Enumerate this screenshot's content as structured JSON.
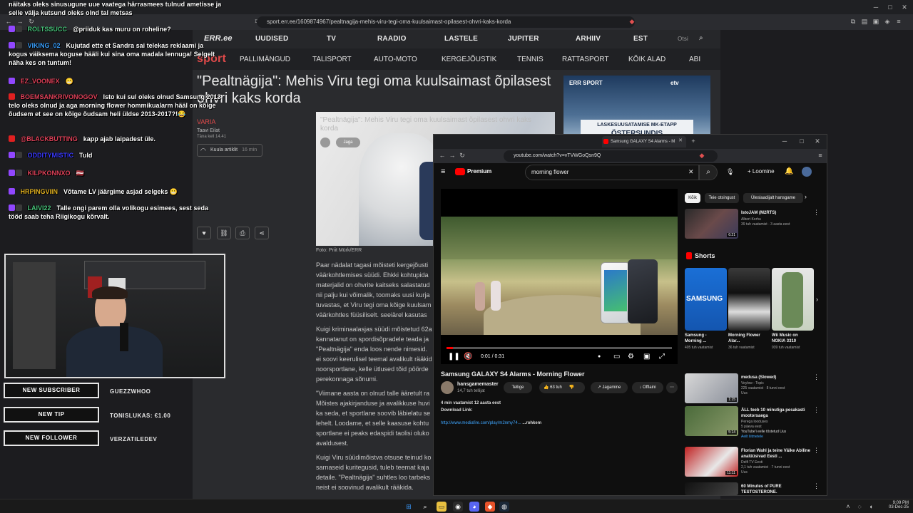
{
  "main_browser": {
    "tab_title": "Samsung GALAXY S4 Alarms - M",
    "url": "sport.err.ee/1609874967/pealtnagija-mehis-viru-tegi-oma-kuulsaimast-opilasest-ohvri-kaks-korda"
  },
  "err": {
    "nav1": [
      "UUDISED",
      "TV",
      "RAADIO",
      "LASTELE",
      "JUPITER",
      "ARHIIV",
      "EST"
    ],
    "search_placeholder": "Otsi",
    "sport_label": "sport",
    "nav2": [
      "PALLIMÄNGUD",
      "TALISPORT",
      "AUTO-MOTO",
      "KERGEJÕUSTIK",
      "TENNIS",
      "RATTASPORT",
      "KÕIK ALAD",
      "ABI"
    ],
    "headline": "\"Pealtnägija\": Mehis Viru tegi oma kuulsaimast õpilasest ohvri kaks korda",
    "category": "VARIA",
    "author": "Taavi Eilat",
    "date": "Täna kell 14.41",
    "listen_label": "Kuula artiklit",
    "listen_duration": "16 min",
    "photo_caption": "Foto: Priit Mürk/ERR",
    "photo_overlay": "\"Pealtnägija\": Mehis Viru tegi oma kuulsaimast õpilasest ohvri kaks korda",
    "photo_share": "Jaga",
    "paragraphs": [
      "Paar nädalat tagasi mõisteti kergejõusti väärkohtlemises süüdi. Ehkki kohtupida materjalid on ohvrite kaitseks salastatud nii palju kui võimalik, toomaks uusi kurja tuvastas, et Viru tegi oma kõige kuulsam väärkohtles füüsiliselt, seejärel kasutas",
      "Kuigi kriminaalasjas süüdi mõistetud 62a kannatanut on spordisõpradele teada ja \"Pealtnägija\" enda loos nende nimesid. ei soovi keerulisel teemal avalikult rääkid noorsportlane, kelle ütlused tõid pöörde perekonnaga sõnumi.",
      "\"Viimane aasta on olnud talle ääretult ra Mõistes ajakirjanduse ja avalikkuse huvi ka seda, et sportlane soovib läbielatu se lehelt. Loodame, et selle kaasuse kohtu sportlane ei peaks edaspidi taolisi oluko avaldusest.",
      "Kuigi Viru süüdimõistva otsuse teinud ko sarnaseid kuritegusid, tuleb teemat kaja detaile. \"Pealtnägija\" suhtles loo tarbeks neist ei soovinud avalikult rääkida."
    ],
    "ad_brand": "ERR SPORT",
    "ad_channel": "etv",
    "ad_text": "LASKESUUSATAMISE MK-ETAPP",
    "ad_text2": "ÖSTERSUNDIS"
  },
  "chat": [
    {
      "user": "",
      "msg": "näitaks oleks sinusugune uue vaatega härrasmees tulnud ametisse ja selle välja kutsund oleks olnd tal metsas",
      "color": "#ffffff"
    },
    {
      "user": "ROLTSSUCC",
      "msg": "@priiduk kas muru on roheline?",
      "color": "#48c27a"
    },
    {
      "user": "VIKING_02",
      "msg": "Kujutad ette et Sandra sai telekas reklaami ja kogus väiksema koguse hääli kui sina oma madala lennuga! Selgelt näha kes on tuntum!",
      "color": "#3aa0ff"
    },
    {
      "user": "EZ_VOONEX",
      "msg": "😬",
      "color": "#e0425a"
    },
    {
      "user": "BOEMSANKRIVONOGOV",
      "msg": "Isto kui sul oleks olnud Samsung 2013 telo oleks olnud ja aga morning flower hommikualarm hääl on kõige õudsem et see on kõige õudsam heli üldse 2013-2017?!😂",
      "color": "#e0425a"
    },
    {
      "user": "@BLACKBUTTING",
      "msg": "kapp ajab laipadest üle.",
      "color": "#e0425a"
    },
    {
      "user": "ODDITYMISTIC",
      "msg": "Tuld",
      "color": "#3a3aff"
    },
    {
      "user": "KILPKONNXO",
      "msg": "🇱🇻",
      "color": "#e0425a"
    },
    {
      "user": "HRPINGVIIN",
      "msg": "Võtame LV jäärgime asjad selgeks 😬",
      "color": "#e0b020"
    },
    {
      "user": "LAIVI22",
      "msg": "Talle ongi parem olla volikogu esimees, sest seda tööd saab teha Riigikogu kõrvalt.",
      "color": "#48c27a"
    }
  ],
  "alerts": [
    {
      "label": "NEW SUBSCRIBER",
      "value": "GUEZZWHOO"
    },
    {
      "label": "NEW TIP",
      "value": "TONISLUKAS: €1.00"
    },
    {
      "label": "NEW FOLLOWER",
      "value": "VERZATILEDEV"
    }
  ],
  "youtube": {
    "tab_title": "Samsung GALAXY S4 Alarms - M",
    "url": "youtube.com/watch?v=vTVWGoQsn9Q",
    "logo": "Premium",
    "search_value": "morning flower",
    "create_label": "Loomine",
    "video_title": "Samsung GALAXY S4 Alarms - Morning Flower",
    "time": "0:01 / 0:31",
    "progress_fraction": 0.03,
    "channel": "hansgamemaster",
    "subs": "14,7 tuh tellijat",
    "subscribe": "Tellige",
    "likes": "63 tuh",
    "share": "Jagamine",
    "offline": "Offlaini",
    "desc_meta": "4 min vaatamist  12 aasta eest",
    "desc_line": "Download Link:",
    "desc_link": "http://www.mediafire.com/play/m2nmy74...",
    "desc_more": "...rohkem",
    "chips": [
      "Kõik",
      "Teie otsingust",
      "Üleslaadijalt hansgame"
    ],
    "shorts_header": "Shorts",
    "top_rec": {
      "title": "IstoJAM (M2RTS)",
      "meta": "Albert Korhu",
      "meta2": "39 tuh vaatamist · 3 aasta eest",
      "dur": "6:21"
    },
    "shorts": [
      {
        "title": "Samsung - Morning ...",
        "views": "405 tuh vaatamist"
      },
      {
        "title": "Morning Flower Alar...",
        "views": "36 tuh vaatamist"
      },
      {
        "title": "Wii Music on NOKIA 3310",
        "views": "939 tuh vaatamist"
      }
    ],
    "recs": [
      {
        "title": "medusa (Slowed)",
        "meta": "Veylow - Topic",
        "meta2": "225 vaatamist · 8 tunni eest",
        "meta3": "Uus",
        "dur": "1:15"
      },
      {
        "title": "ÄLL teeb 10 minutiga pesakasti mootorsaega",
        "meta": "Perega looduses",
        "meta2": "5 päeva eest",
        "meta3": "YouTube'i eelle tõstetud Uus",
        "meta4": "Aeilt liitmetele",
        "dur": "5:14"
      },
      {
        "title": "Florian Wahl ja teine Väike Abiline analüüsivad Eesti ...",
        "meta": "Delfi TV Eesti",
        "meta2": "2,1 tuh vaatamist · 7 tunni eest",
        "meta3": "Uus",
        "dur": "11:11"
      },
      {
        "title": "60 Minutes of PURE TESTOSTERONE.",
        "meta": "",
        "meta2": "",
        "meta3": "",
        "dur": ""
      }
    ]
  },
  "taskbar": {
    "time": "9:09 PM",
    "date": "03-Dec-25"
  }
}
